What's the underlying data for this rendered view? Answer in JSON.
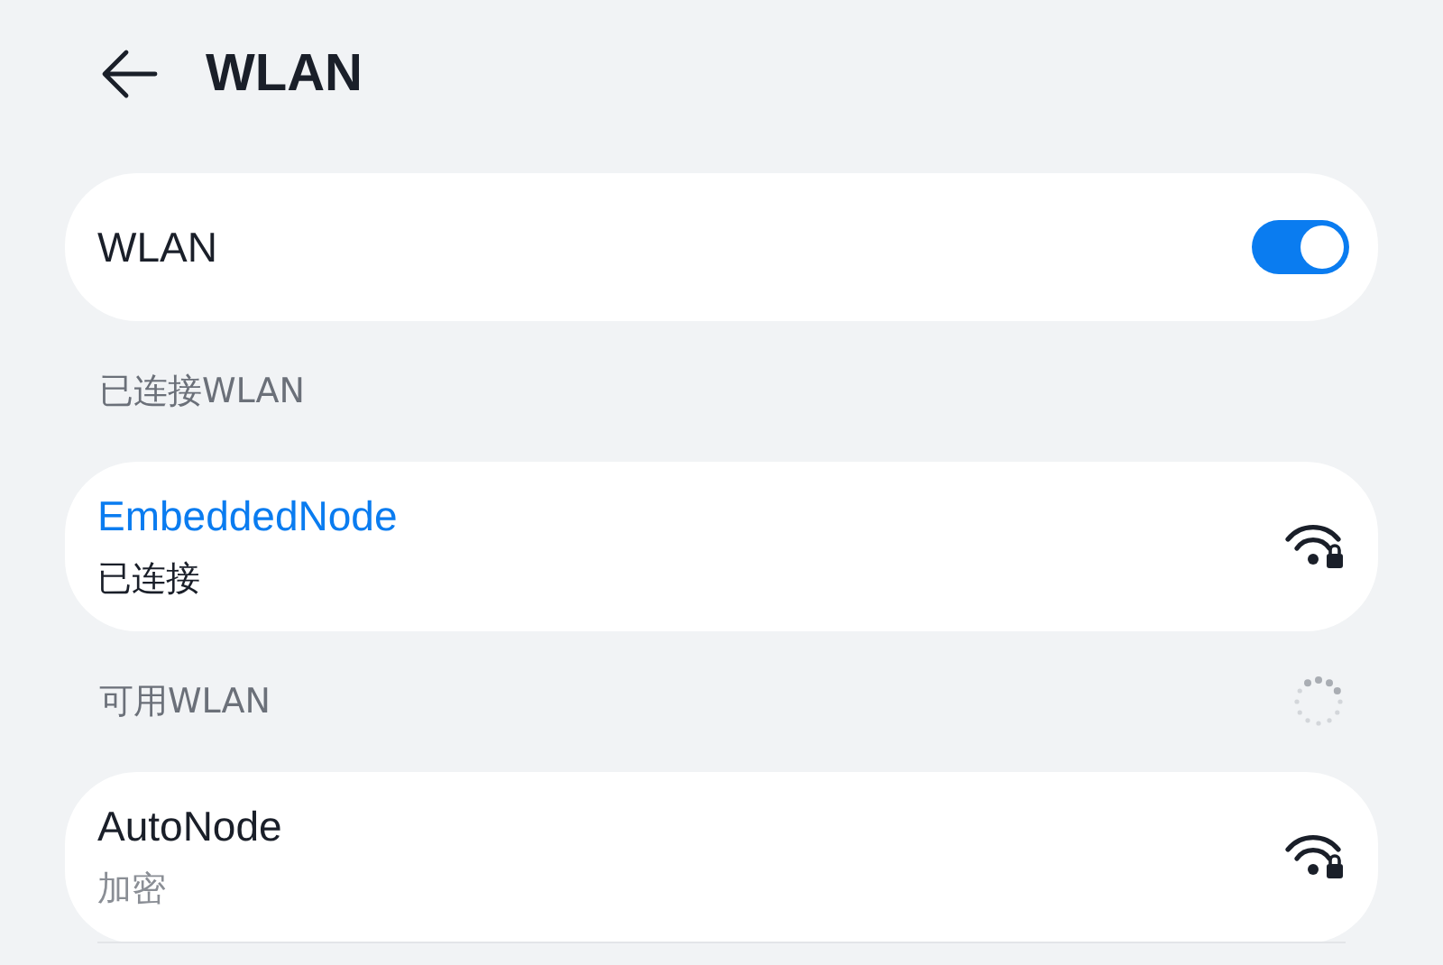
{
  "header": {
    "title": "WLAN"
  },
  "toggle_card": {
    "label": "WLAN",
    "on": true
  },
  "sections": [
    {
      "title": "已连接WLAN",
      "scanning": false,
      "networks": [
        {
          "name": "EmbeddedNode",
          "status": "已连接",
          "connected": true
        }
      ]
    },
    {
      "title": "可用WLAN",
      "scanning": true,
      "networks": [
        {
          "name": "AutoNode",
          "status": "加密",
          "connected": false
        }
      ]
    }
  ]
}
